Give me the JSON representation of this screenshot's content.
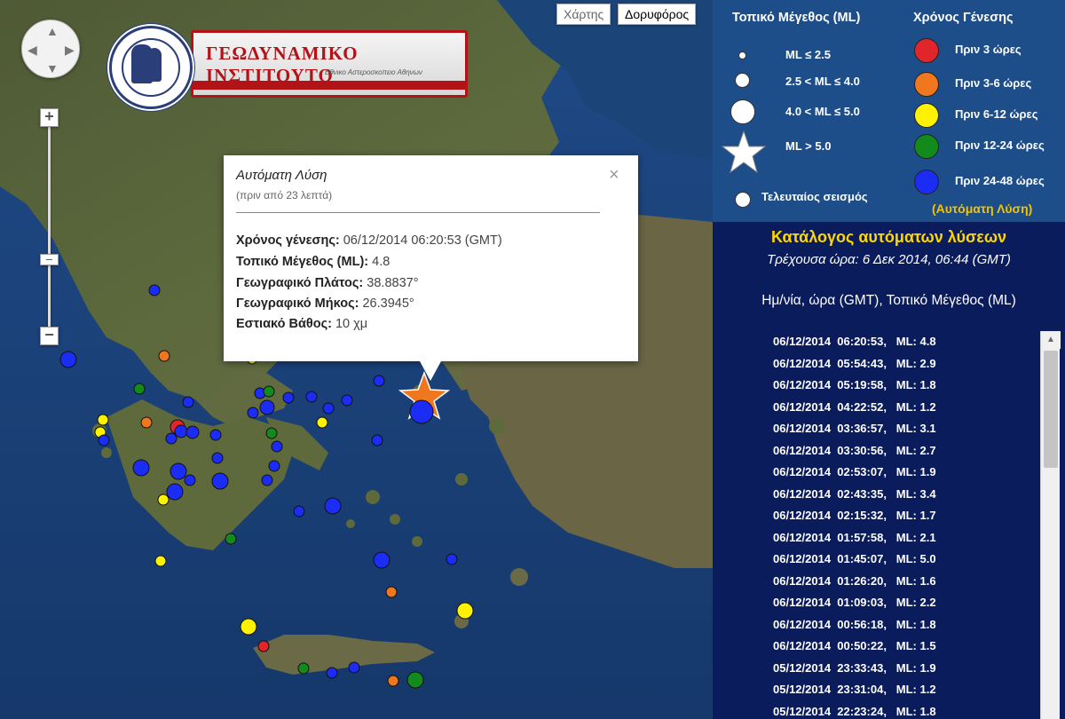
{
  "map": {
    "map_type_map": "Χάρτης",
    "map_type_satellite": "Δορυφόρος",
    "zoom_in": "+",
    "zoom_out": "−",
    "zoom_thumb": "−"
  },
  "logo": {
    "title": "ΓΕΩΔΥΝΑΜΙΚΟ ΙΝΣΤΙΤΟΥΤΟ",
    "subtitle": "Εθνικο Αστεροσκοπειο Αθηνων"
  },
  "infowindow": {
    "title": "Αυτόματη Λύση",
    "subtitle": "(πριν από 23 λεπτά)",
    "close": "×",
    "rows": [
      {
        "label": "Χρόνος γένεσης:",
        "value": "06/12/2014  06:20:53 (GMT)"
      },
      {
        "label": "Τοπικό Μέγεθος (ML):",
        "value": "4.8"
      },
      {
        "label": "Γεωγραφικό Πλάτος:",
        "value": "38.8837°"
      },
      {
        "label": "Γεωγραφικό Μήκος:",
        "value": "26.3945°"
      },
      {
        "label": "Εστιακό Βάθος:",
        "value": "10 χμ"
      }
    ]
  },
  "legend": {
    "size_header": "Τοπικό Μέγεθος (ML)",
    "time_header": "Χρόνος Γένεσης",
    "sizes": [
      "ML ≤ 2.5",
      "2.5 < ML ≤ 4.0",
      "4.0 < ML ≤ 5.0",
      "ML > 5.0",
      "Τελευταίος σεισμός"
    ],
    "times": [
      {
        "label": "Πριν 3 ώρες",
        "color": "#e0262b"
      },
      {
        "label": "Πριν 3-6 ώρες",
        "color": "#f0771e"
      },
      {
        "label": "Πριν 6-12 ώρες",
        "color": "#fff200"
      },
      {
        "label": "Πριν 12-24 ώρες",
        "color": "#138a1c"
      },
      {
        "label": "Πριν 24-48 ώρες",
        "color": "#1b2cf5"
      }
    ],
    "auto_label": "(Αυτόματη Λύση)"
  },
  "catalog": {
    "title": "Κατάλογος αυτόματων λύσεων",
    "current_time": "Τρέχουσα ώρα: 6 Δεκ 2014, 06:44 (GMT)",
    "header": "Ημ/νία, ώρα (GMT), Τοπικό Μέγεθος (ML)",
    "rows": [
      "06/12/2014  06:20:53,   ML: 4.8",
      "06/12/2014  05:54:43,   ML: 2.9",
      "06/12/2014  05:19:58,   ML: 1.8",
      "06/12/2014  04:22:52,   ML: 1.2",
      "06/12/2014  03:36:57,   ML: 3.1",
      "06/12/2014  03:30:56,   ML: 2.7",
      "06/12/2014  02:53:07,   ML: 1.9",
      "06/12/2014  02:43:35,   ML: 3.4",
      "06/12/2014  02:15:32,   ML: 1.7",
      "06/12/2014  01:57:58,   ML: 2.1",
      "06/12/2014  01:45:07,   ML: 5.0",
      "06/12/2014  01:26:20,   ML: 1.6",
      "06/12/2014  01:09:03,   ML: 2.2",
      "06/12/2014  00:56:18,   ML: 1.8",
      "06/12/2014  00:50:22,   ML: 1.5",
      "05/12/2014  23:33:43,   ML: 1.9",
      "05/12/2014  23:31:04,   ML: 1.2",
      "05/12/2014  22:23:24,   ML: 1.8"
    ]
  }
}
